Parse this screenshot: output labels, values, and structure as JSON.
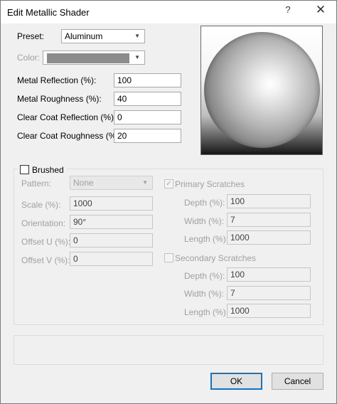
{
  "window": {
    "title": "Edit Metallic Shader",
    "help_glyph": "?",
    "close_glyph": "✕"
  },
  "preset": {
    "label": "Preset:",
    "value": "Aluminum"
  },
  "color": {
    "label": "Color:",
    "swatch_color": "#8c8c8c"
  },
  "fields": {
    "metal_reflection": {
      "label": "Metal Reflection (%):",
      "value": "100"
    },
    "metal_roughness": {
      "label": "Metal Roughness (%):",
      "value": "40"
    },
    "clear_coat_reflection": {
      "label": "Clear Coat Reflection (%):",
      "value": "0"
    },
    "clear_coat_roughness": {
      "label": "Clear Coat Roughness (%):",
      "value": "20"
    }
  },
  "brushed": {
    "label": "Brushed",
    "checked": false,
    "pattern": {
      "label": "Pattern:",
      "value": "None"
    },
    "scale": {
      "label": "Scale (%):",
      "value": "1000"
    },
    "orientation": {
      "label": "Orientation:",
      "value": "90°"
    },
    "offset_u": {
      "label": "Offset U (%):",
      "value": "0"
    },
    "offset_v": {
      "label": "Offset V (%):",
      "value": "0"
    },
    "primary": {
      "label": "Primary Scratches",
      "checked": true,
      "depth": {
        "label": "Depth (%):",
        "value": "100"
      },
      "width": {
        "label": "Width (%):",
        "value": "7"
      },
      "length": {
        "label": "Length (%):",
        "value": "1000"
      }
    },
    "secondary": {
      "label": "Secondary Scratches",
      "checked": false,
      "depth": {
        "label": "Depth (%):",
        "value": "100"
      },
      "width": {
        "label": "Width (%):",
        "value": "7"
      },
      "length": {
        "label": "Length (%):",
        "value": "1000"
      }
    }
  },
  "buttons": {
    "ok": "OK",
    "cancel": "Cancel"
  },
  "icons": {
    "dropdown": "chevron-down-icon",
    "check": "checkmark-icon"
  }
}
